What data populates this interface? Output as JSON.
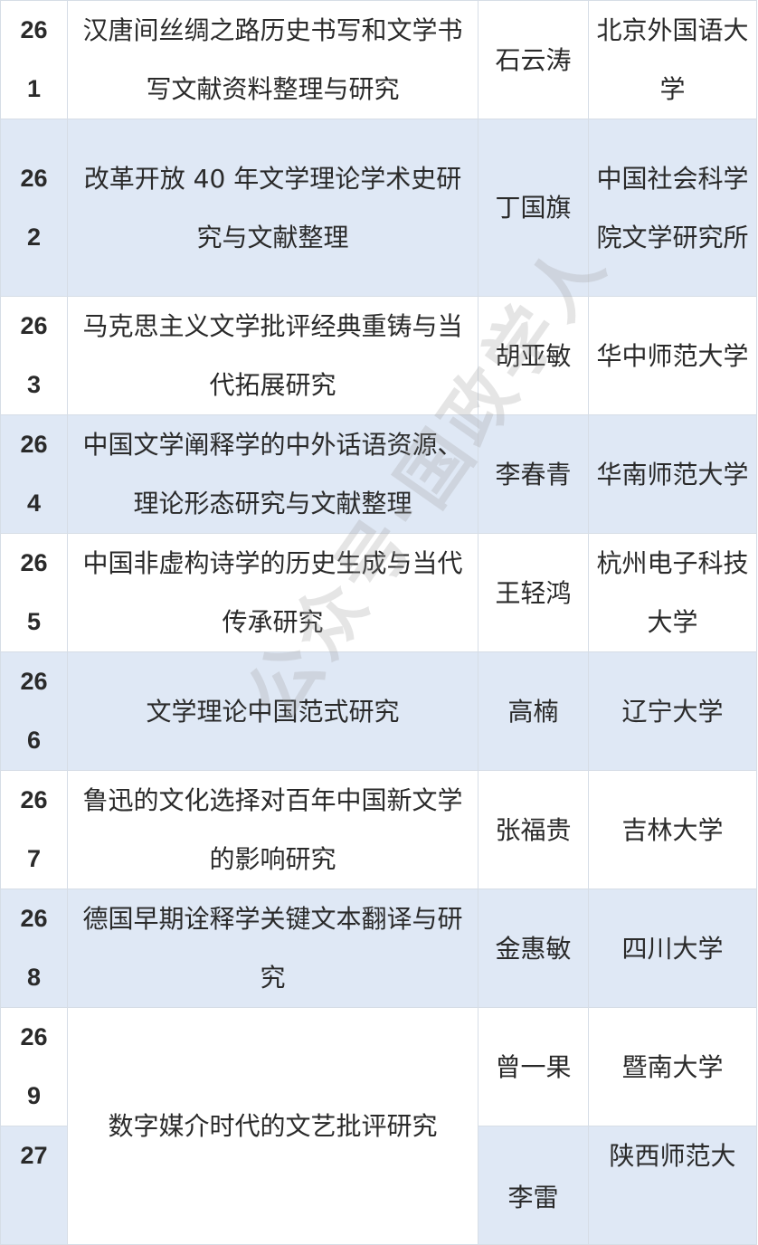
{
  "rows": [
    {
      "id_line1": "26",
      "id_line2": "1",
      "title": "汉唐间丝绸之路历史书写和文学书写文献资料整理与研究",
      "person": "石云涛",
      "org": "北京外国语大学"
    },
    {
      "id_line1": "26",
      "id_line2": "2",
      "title": "改革开放 40 年文学理论学术史研究与文献整理",
      "person": "丁国旗",
      "org": "中国社会科学院文学研究所"
    },
    {
      "id_line1": "26",
      "id_line2": "3",
      "title": "马克思主义文学批评经典重铸与当代拓展研究",
      "person": "胡亚敏",
      "org": "华中师范大学"
    },
    {
      "id_line1": "26",
      "id_line2": "4",
      "title": "中国文学阐释学的中外话语资源、理论形态研究与文献整理",
      "person": "李春青",
      "org": "华南师范大学"
    },
    {
      "id_line1": "26",
      "id_line2": "5",
      "title": "中国非虚构诗学的历史生成与当代传承研究",
      "person": "王轻鸿",
      "org": "杭州电子科技大学"
    },
    {
      "id_line1": "26",
      "id_line2": "6",
      "title": "文学理论中国范式研究",
      "person": "高楠",
      "org": "辽宁大学"
    },
    {
      "id_line1": "26",
      "id_line2": "7",
      "title": "鲁迅的文化选择对百年中国新文学的影响研究",
      "person": "张福贵",
      "org": "吉林大学"
    },
    {
      "id_line1": "26",
      "id_line2": "8",
      "title": "德国早期诠释学关键文本翻译与研究",
      "person": "金惠敏",
      "org": "四川大学"
    },
    {
      "id_line1": "26",
      "id_line2": "9",
      "title": "数字媒介时代的文艺批评研究",
      "person": "曾一果",
      "org": "暨南大学"
    },
    {
      "id_line1": "27",
      "id_line2": "",
      "title": "",
      "person": "李雷",
      "org": "陕西师范大"
    }
  ],
  "watermark": "公众号·国政学人"
}
